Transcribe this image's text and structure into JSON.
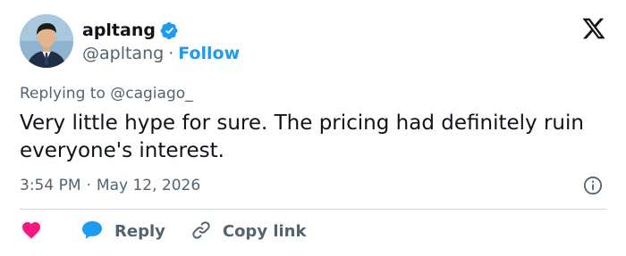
{
  "author": {
    "name": "apltang",
    "handle": "@apltang",
    "separator": "·",
    "follow_label": "Follow",
    "avatar_icon": "user-photo-avatar",
    "verified_icon": "verified-badge-icon"
  },
  "reply": {
    "prefix": "Replying to",
    "handle": "@cagiago_"
  },
  "tweet": {
    "text": "Very little hype for sure. The pricing had definitely ruin everyone's interest."
  },
  "meta": {
    "time": "3:54 PM",
    "separator": "·",
    "date": "May 12, 2026"
  },
  "actions": {
    "like_icon": "heart-icon",
    "reply_icon": "speech-bubble-icon",
    "reply_label": "Reply",
    "copy_icon": "link-icon",
    "copy_label": "Copy link"
  },
  "colors": {
    "accent": "#1d9bf0",
    "like": "#f91880",
    "text_primary": "#0f1419",
    "text_secondary": "#536471",
    "divider": "#cfd9de"
  }
}
